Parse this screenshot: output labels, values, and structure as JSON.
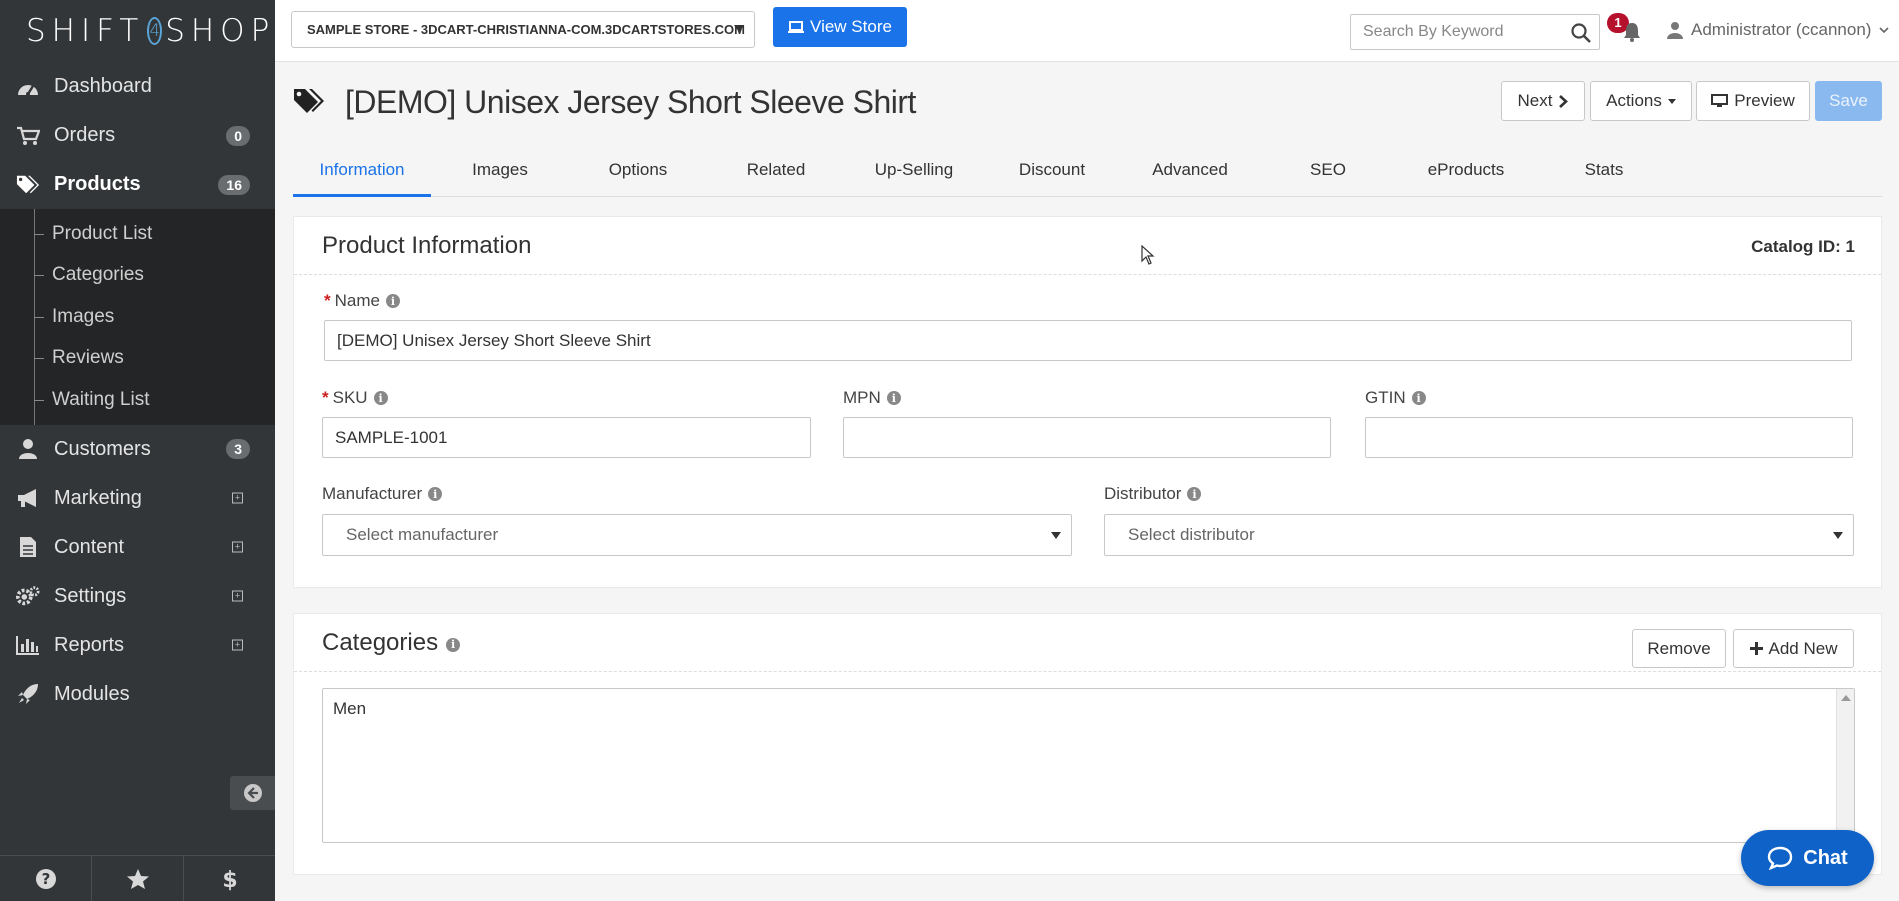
{
  "brand": {
    "logo_left": "SHIFT",
    "logo_digit": "4",
    "logo_right": "SHOP"
  },
  "sidebar": {
    "items": [
      {
        "label": "Dashboard",
        "icon": "dashboard-icon"
      },
      {
        "label": "Orders",
        "icon": "cart-icon",
        "badge": "0"
      },
      {
        "label": "Products",
        "icon": "tags-icon",
        "badge": "16",
        "active": true
      },
      {
        "label": "Customers",
        "icon": "user-icon",
        "badge": "3"
      },
      {
        "label": "Marketing",
        "icon": "megaphone-icon",
        "expand": "+"
      },
      {
        "label": "Content",
        "icon": "document-icon",
        "expand": "+"
      },
      {
        "label": "Settings",
        "icon": "gears-icon",
        "expand": "+"
      },
      {
        "label": "Reports",
        "icon": "bar-chart-icon",
        "expand": "+"
      },
      {
        "label": "Modules",
        "icon": "rocket-icon"
      }
    ],
    "products_sub": [
      "Product List",
      "Categories",
      "Images",
      "Reviews",
      "Waiting List"
    ],
    "footer_icons": [
      "help-icon",
      "star-icon",
      "dollar-icon"
    ]
  },
  "topbar": {
    "store_name": "SAMPLE STORE - 3DCART-CHRISTIANNA-COM.3DCARTSTORES.COM",
    "view_store_label": "View Store",
    "search_placeholder": "Search By Keyword",
    "notification_count": "1",
    "admin_label": "Administrator (ccannon)"
  },
  "page": {
    "title": "[DEMO] Unisex Jersey Short Sleeve Shirt",
    "buttons": {
      "next": "Next",
      "actions": "Actions",
      "preview": "Preview",
      "save": "Save"
    }
  },
  "tabs": [
    "Information",
    "Images",
    "Options",
    "Related",
    "Up-Selling",
    "Discount",
    "Advanced",
    "SEO",
    "eProducts",
    "Stats"
  ],
  "active_tab": "Information",
  "product_info": {
    "heading": "Product Information",
    "catalog_id": "Catalog ID: 1",
    "name_label": "Name",
    "name_value": "[DEMO] Unisex Jersey Short Sleeve Shirt",
    "sku_label": "SKU",
    "sku_value": "SAMPLE-1001",
    "mpn_label": "MPN",
    "mpn_value": "",
    "gtin_label": "GTIN",
    "gtin_value": "",
    "manufacturer_label": "Manufacturer",
    "manufacturer_placeholder": "Select manufacturer",
    "distributor_label": "Distributor",
    "distributor_placeholder": "Select distributor"
  },
  "categories": {
    "heading": "Categories",
    "remove_label": "Remove",
    "add_label": "Add New",
    "items": [
      "Men"
    ]
  },
  "chat_label": "Chat",
  "colors": {
    "accent": "#1a73e8",
    "sidebar_bg": "#333638",
    "badge_red": "#b5112c",
    "save_disabled": "#8ab9ef"
  }
}
